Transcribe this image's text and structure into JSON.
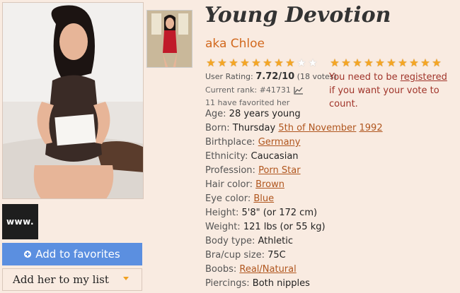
{
  "model": {
    "name": "Young Devotion",
    "aka": "aka Chloe",
    "stars_filled_user": 7.72,
    "stars_total": 10
  },
  "rating": {
    "user_label": "User Rating:",
    "user_value": "7.72/10",
    "votes": "(18 votes)",
    "rank_label": "Current rank: #41731",
    "favorited": "11 have favorited her"
  },
  "vote_notice": {
    "prefix": "You need to be ",
    "link": "registered",
    "suffix": "if you want your vote to count."
  },
  "facts": {
    "age_label": "Age:",
    "age_value": "28 years young",
    "born_label": "Born:",
    "born_day": "Thursday",
    "born_date": "5th of November",
    "born_year": "1992",
    "birthplace_label": "Birthplace:",
    "birthplace_value": "Germany",
    "ethnicity_label": "Ethnicity:",
    "ethnicity_value": "Caucasian",
    "profession_label": "Profession:",
    "profession_value": "Porn Star",
    "hair_label": "Hair color:",
    "hair_value": "Brown",
    "eye_label": "Eye color:",
    "eye_value": "Blue",
    "height_label": "Height:",
    "height_value": "5'8\" (or 172 cm)",
    "weight_label": "Weight:",
    "weight_value": "121 lbs (or 55 kg)",
    "body_label": "Body type:",
    "body_value": "Athletic",
    "bra_label": "Bra/cup size:",
    "bra_value": "75C",
    "boobs_label": "Boobs:",
    "boobs_value": "Real/Natural",
    "piercings_label": "Piercings:",
    "piercings_value": "Both nipples"
  },
  "sidebar": {
    "www_label": "www.",
    "add_favorites": "Add to favorites",
    "add_list": "Add her to my list"
  },
  "colors": {
    "background": "#f9ebe1",
    "accent_link": "#b0561e",
    "aka": "#d2691e",
    "button_blue": "#5b8fe0",
    "star": "#f5a623",
    "notice": "#a0342a"
  }
}
